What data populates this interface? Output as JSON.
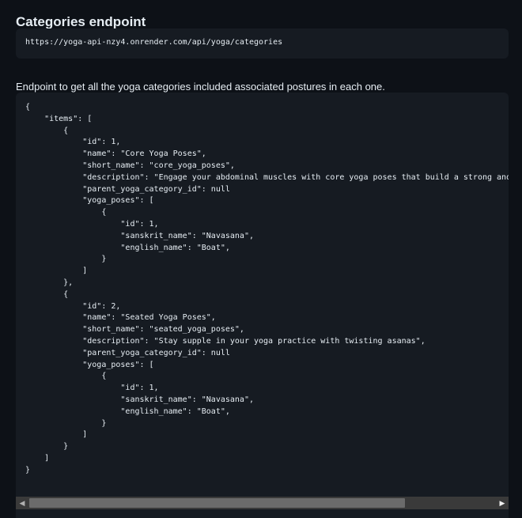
{
  "section": {
    "title": "Categories endpoint",
    "url": "https://yoga-api-nzy4.onrender.com/api/yoga/categories",
    "description": "Endpoint to get all the yoga categories included associated postures in each one."
  },
  "code_block": {
    "lines": [
      "{",
      "    \"items\": [",
      "        {",
      "            \"id\": 1,",
      "            \"name\": \"Core Yoga Poses\",",
      "            \"short_name\": \"core_yoga_poses\",",
      "            \"description\": \"Engage your abdominal muscles with core yoga poses that build a strong and stable",
      "            \"parent_yoga_category_id\": null",
      "            \"yoga_poses\": [",
      "                {",
      "                    \"id\": 1,",
      "                    \"sanskrit_name\": \"Navasana\",",
      "                    \"english_name\": \"Boat\",",
      "                }",
      "            ]",
      "        },",
      "        {",
      "            \"id\": 2,",
      "            \"name\": \"Seated Yoga Poses\",",
      "            \"short_name\": \"seated_yoga_poses\",",
      "            \"description\": \"Stay supple in your yoga practice with twisting asanas\",",
      "            \"parent_yoga_category_id\": null",
      "            \"yoga_poses\": [",
      "                {",
      "                    \"id\": 1,",
      "                    \"sanskrit_name\": \"Navasana\",",
      "                    \"english_name\": \"Boat\",",
      "                }",
      "            ]",
      "        }",
      "    ]",
      "}"
    ]
  },
  "scrollbar": {
    "left_icon": "triangle-left-icon",
    "right_icon": "triangle-right-icon",
    "left_glyph": "◀",
    "right_glyph": "▶"
  },
  "colors": {
    "page_background": "#0d1117",
    "block_background": "#161b22",
    "text": "#e6edf3",
    "scrollbar_track": "#3a3a3a",
    "scrollbar_thumb": "#6b6b6b"
  }
}
